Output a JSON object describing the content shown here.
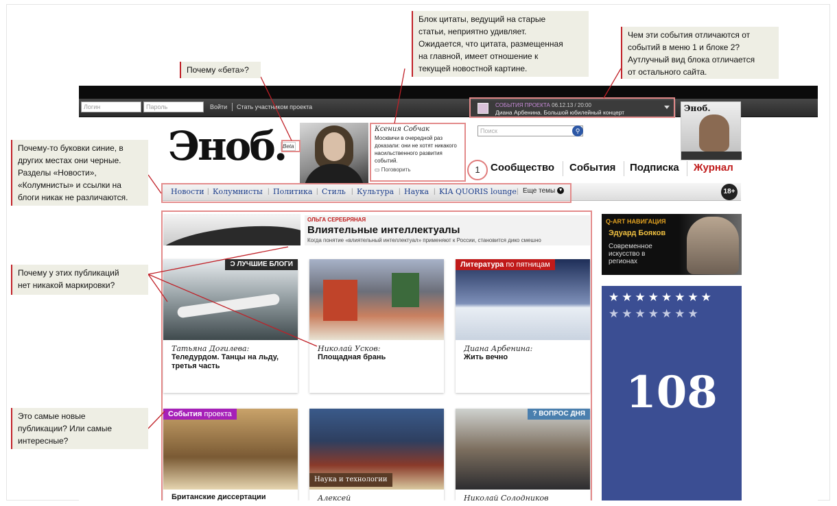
{
  "callouts": {
    "beta": "Почему «бета»?",
    "quote_block": [
      "Блок цитаты, ведущий на старые",
      "статьи, неприятно  удивляет.",
      "Ожидается, что цитата, размещенная",
      "на главной, имеет отношение  к",
      "текущей  новостной картине."
    ],
    "events": [
      "Чем эти события отличаются от",
      "событий в меню  1 и блоке 2?",
      "Аутлучный вид  блока отличается",
      "от  остального сайта."
    ],
    "letters": [
      "Почему-то буковки синие,  в",
      "других местах они черные.",
      "Разделы «Новости»,",
      "«Колумнисты» и ссылки на",
      "блоги никак не различаются."
    ],
    "no_marking": [
      "Почему у этих публикаций",
      "нет никакой маркировки?"
    ],
    "newest": [
      "Это самые новые",
      "публикации? Или самые",
      "интересные?"
    ],
    "circle_number": "1"
  },
  "login": {
    "login_placeholder": "Логин",
    "password_placeholder": "Пароль",
    "login_button": "Войти",
    "register_link": "Стать участником проекта"
  },
  "event_widget": {
    "label": "СОБЫТИЯ ПРОЕКТА",
    "datetime": "06.12.13 / 20:00",
    "title": "Диана Арбенина. Большой юбилейный концерт"
  },
  "logo": {
    "text": "Эноб.",
    "beta": "Beta"
  },
  "quote": {
    "author": "Ксения Собчак",
    "text": "Москвичи в очередной раз доказали: они не хотят никакого насильственного развития событий.",
    "talk": "Поговорить"
  },
  "search": {
    "placeholder": "Поиск",
    "button_icon": "search-icon"
  },
  "magazine": {
    "logo": "Эноб."
  },
  "main_nav": [
    "Сообщество",
    "События",
    "Подписка",
    "Журнал"
  ],
  "rubrics": [
    "Новости",
    "Колумнисты",
    "Политика",
    "Стиль",
    "Культура",
    "Наука",
    "KIA QUORIS lounge"
  ],
  "more_topics": "Еще темы",
  "age_badge": "18+",
  "feature": {
    "author": "ОЛЬГА СЕРЕБРЯНАЯ",
    "title": "Влиятельные интеллектуалы",
    "lead": "Когда понятие «влиятельный интеллектуал» применяют к России, становится дико смешно"
  },
  "cards": [
    {
      "tag": "ЛУЧШИЕ БЛОГИ",
      "author": "Татьяна Догилева:",
      "title": "Теледурдом. Танцы на льду, третья часть"
    },
    {
      "tag": "",
      "author": "Николай Усков:",
      "title": "Площадная брань"
    },
    {
      "tag_strong": "Литература",
      "tag": "по пятницам",
      "author": "Диана Арбенина:",
      "title": "Жить вечно"
    },
    {
      "tag_strong": "События",
      "tag": "проекта",
      "author": "",
      "title": "Британские диссертации"
    },
    {
      "tag": "Наука и технологии",
      "author": "Алексей",
      "title": ""
    },
    {
      "tag": "ВОПРОС ДНЯ",
      "author": "Николай Солодников",
      "title": ""
    }
  ],
  "ads": {
    "qart": {
      "head": "Q-ART НАВИГАЦИЯ",
      "name": "Эдуард Бояков",
      "sub": "Современное искусство в регионах"
    },
    "big": {
      "number": "108"
    }
  },
  "colors": {
    "accent_red": "#c01a1a",
    "link_blue": "#1a3c8a",
    "annotation_box": "#e38a8a",
    "ad_blue": "#3b4e93"
  }
}
